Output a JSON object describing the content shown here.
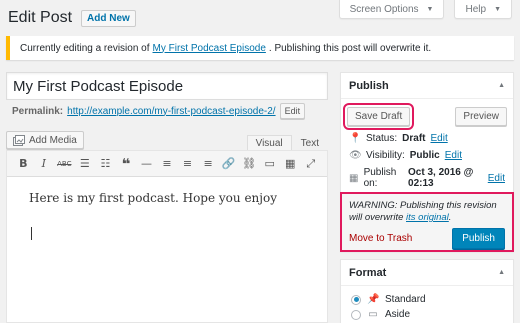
{
  "screen_options": {
    "label": "Screen Options"
  },
  "help": {
    "label": "Help"
  },
  "page": {
    "title": "Edit Post",
    "add_new": "Add New"
  },
  "notice": {
    "prefix": "Currently editing a revision of",
    "link": "My First Podcast Episode",
    "suffix": ". Publishing this post will overwrite it."
  },
  "post": {
    "title": "My First Podcast Episode",
    "permalink_label": "Permalink:",
    "permalink_url": "http://example.com/my-first-podcast-episode-2/",
    "edit_label": "Edit"
  },
  "editor": {
    "add_media": "Add Media",
    "tabs": [
      "Visual",
      "Text"
    ],
    "active_tab": "Visual",
    "toolbar": [
      "bold-icon",
      "italic-icon",
      "strikethrough-icon",
      "bulleted-list-icon",
      "numbered-list-icon",
      "blockquote-icon",
      "horizontal-line-icon",
      "align-left-icon",
      "align-center-icon",
      "align-right-icon",
      "insert-link-icon",
      "remove-link-icon",
      "insert-more-icon",
      "toolbar-toggle-icon",
      "fullscreen-icon"
    ],
    "content": "Here is my first podcast. Hope you enjoy"
  },
  "publish_box": {
    "title": "Publish",
    "save_draft": "Save Draft",
    "preview": "Preview",
    "status_label": "Status:",
    "status_value": "Draft",
    "visibility_label": "Visibility:",
    "visibility_value": "Public",
    "publish_on_label": "Publish on:",
    "publish_on_value": "Oct 3, 2016 @ 02:13",
    "edit_link": "Edit",
    "warning_prefix": "WARNING: Publishing this revision will overwrite",
    "warning_link": "its original",
    "warning_suffix": ".",
    "move_to_trash": "Move to Trash",
    "publish_button": "Publish"
  },
  "format_box": {
    "title": "Format",
    "options": [
      {
        "label": "Standard",
        "selected": true,
        "icon": "pin-icon"
      },
      {
        "label": "Aside",
        "selected": false,
        "icon": "aside-icon"
      }
    ]
  },
  "colors": {
    "accent": "#0085ba",
    "highlight": "#e0195d",
    "notice": "#ffb900",
    "link": "#0073aa"
  }
}
